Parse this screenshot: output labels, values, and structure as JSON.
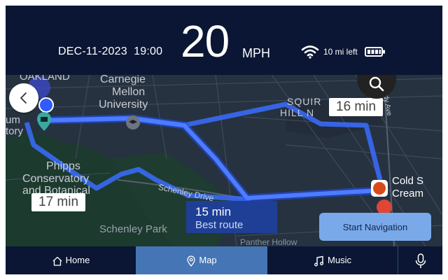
{
  "status": {
    "date": "DEC-11-2023",
    "time": "19:00",
    "speed": "20",
    "speed_unit": "MPH",
    "range": "10 mi left"
  },
  "map": {
    "labels": {
      "oakland": "OAKLAND",
      "carnegie_1": "Carnegie",
      "carnegie_2": "Mellon",
      "carnegie_3": "University",
      "museum_1": "um",
      "museum_2": "tory",
      "phipps_1": "Phipps",
      "phipps_2": "Conservatory",
      "phipps_3": "and Botanical",
      "squirrel_1": "SQUIR",
      "squirrel_2": "HILL N",
      "schenley_drive": "Schenley Drive",
      "schenley_park": "Schenley Park",
      "cold_1": "Cold S",
      "cold_2": "Cream",
      "shady": "Shady Ave",
      "bottom": "Panther Hollow"
    },
    "routes": [
      {
        "eta": "16 min"
      },
      {
        "eta": "17 min"
      },
      {
        "eta": "15 min",
        "subtitle": "Best route"
      }
    ]
  },
  "actions": {
    "start_navigation": "Start Navigation"
  },
  "navbar": {
    "items": [
      {
        "label": "Home"
      },
      {
        "label": "Map"
      },
      {
        "label": "Music"
      }
    ]
  },
  "colors": {
    "background": "#0a1633",
    "route": "#2f5bff",
    "active_tab": "#4575b4",
    "button": "#7aa9e9"
  }
}
